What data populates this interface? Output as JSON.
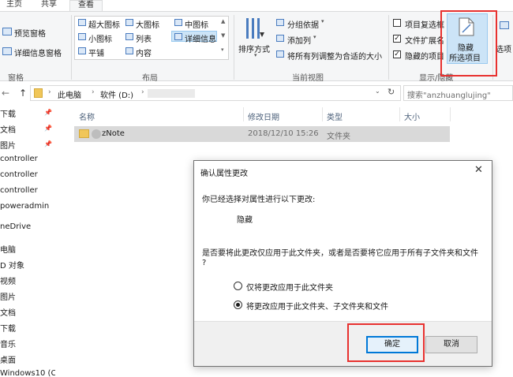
{
  "tabs": [
    "主页",
    "共享",
    "查看"
  ],
  "ribbon": {
    "pane_group": {
      "preview_pane": "预览窗格",
      "details_pane": "详细信息窗格",
      "label": "窗格"
    },
    "layout_group": {
      "extra_large": "超大图标",
      "large": "大图标",
      "medium": "中图标",
      "small": "小图标",
      "list": "列表",
      "details": "详细信息",
      "tiles": "平铺",
      "content": "内容",
      "label": "布局"
    },
    "current_view_group": {
      "sort_by": "排序方式",
      "group_by": "分组依据",
      "add_columns": "添加列",
      "size_all_columns": "将所有列调整为合适的大小",
      "label": "当前视图"
    },
    "show_hide_group": {
      "item_checkboxes": "项目复选框",
      "file_extensions": "文件扩展名",
      "hidden_items": "隐藏的项目",
      "hide_selected_line1": "隐藏",
      "hide_selected_line2": "所选项目",
      "label": "显示/隐藏"
    },
    "options_label": "选项",
    "checkboxes": {
      "item_checkboxes": false,
      "file_extensions": true,
      "hidden_items": true
    }
  },
  "address": {
    "segments": [
      "此电脑",
      "软件 (D:)"
    ],
    "search_placeholder": "搜索\"anzhuanglujing\""
  },
  "nav_items": [
    "下载",
    "文档",
    "图片",
    "controller",
    "controller",
    "controller",
    "poweradmin",
    "neDrive",
    "电脑",
    "D 对象",
    "视频",
    "图片",
    "文档",
    "下载",
    "音乐",
    "桌面",
    "Windows10 (C:"
  ],
  "columns": [
    "名称",
    "修改日期",
    "类型",
    "大小"
  ],
  "rows": [
    {
      "name": "zNote",
      "date": "2018/12/10 15:26",
      "type": "文件夹",
      "size": ""
    }
  ],
  "dialog": {
    "title": "确认属性更改",
    "intro": "你已经选择对属性进行以下更改:",
    "change": "隐藏",
    "question_line1": "是否要将此更改仅应用于此文件夹，或者是否要将它应用于所有子文件夹和文件",
    "question_line2": "?",
    "option_this_folder": "仅将更改应用于此文件夹",
    "option_all": "将更改应用于此文件夹、子文件夹和文件",
    "selected_option": "all",
    "ok": "确定",
    "cancel": "取消"
  },
  "colors": {
    "ribbon_bg": "#f5f6f7",
    "selection": "#cce4f7",
    "highlight": "#e8312f",
    "accent": "#0078d7",
    "folder": "#f0c659"
  }
}
